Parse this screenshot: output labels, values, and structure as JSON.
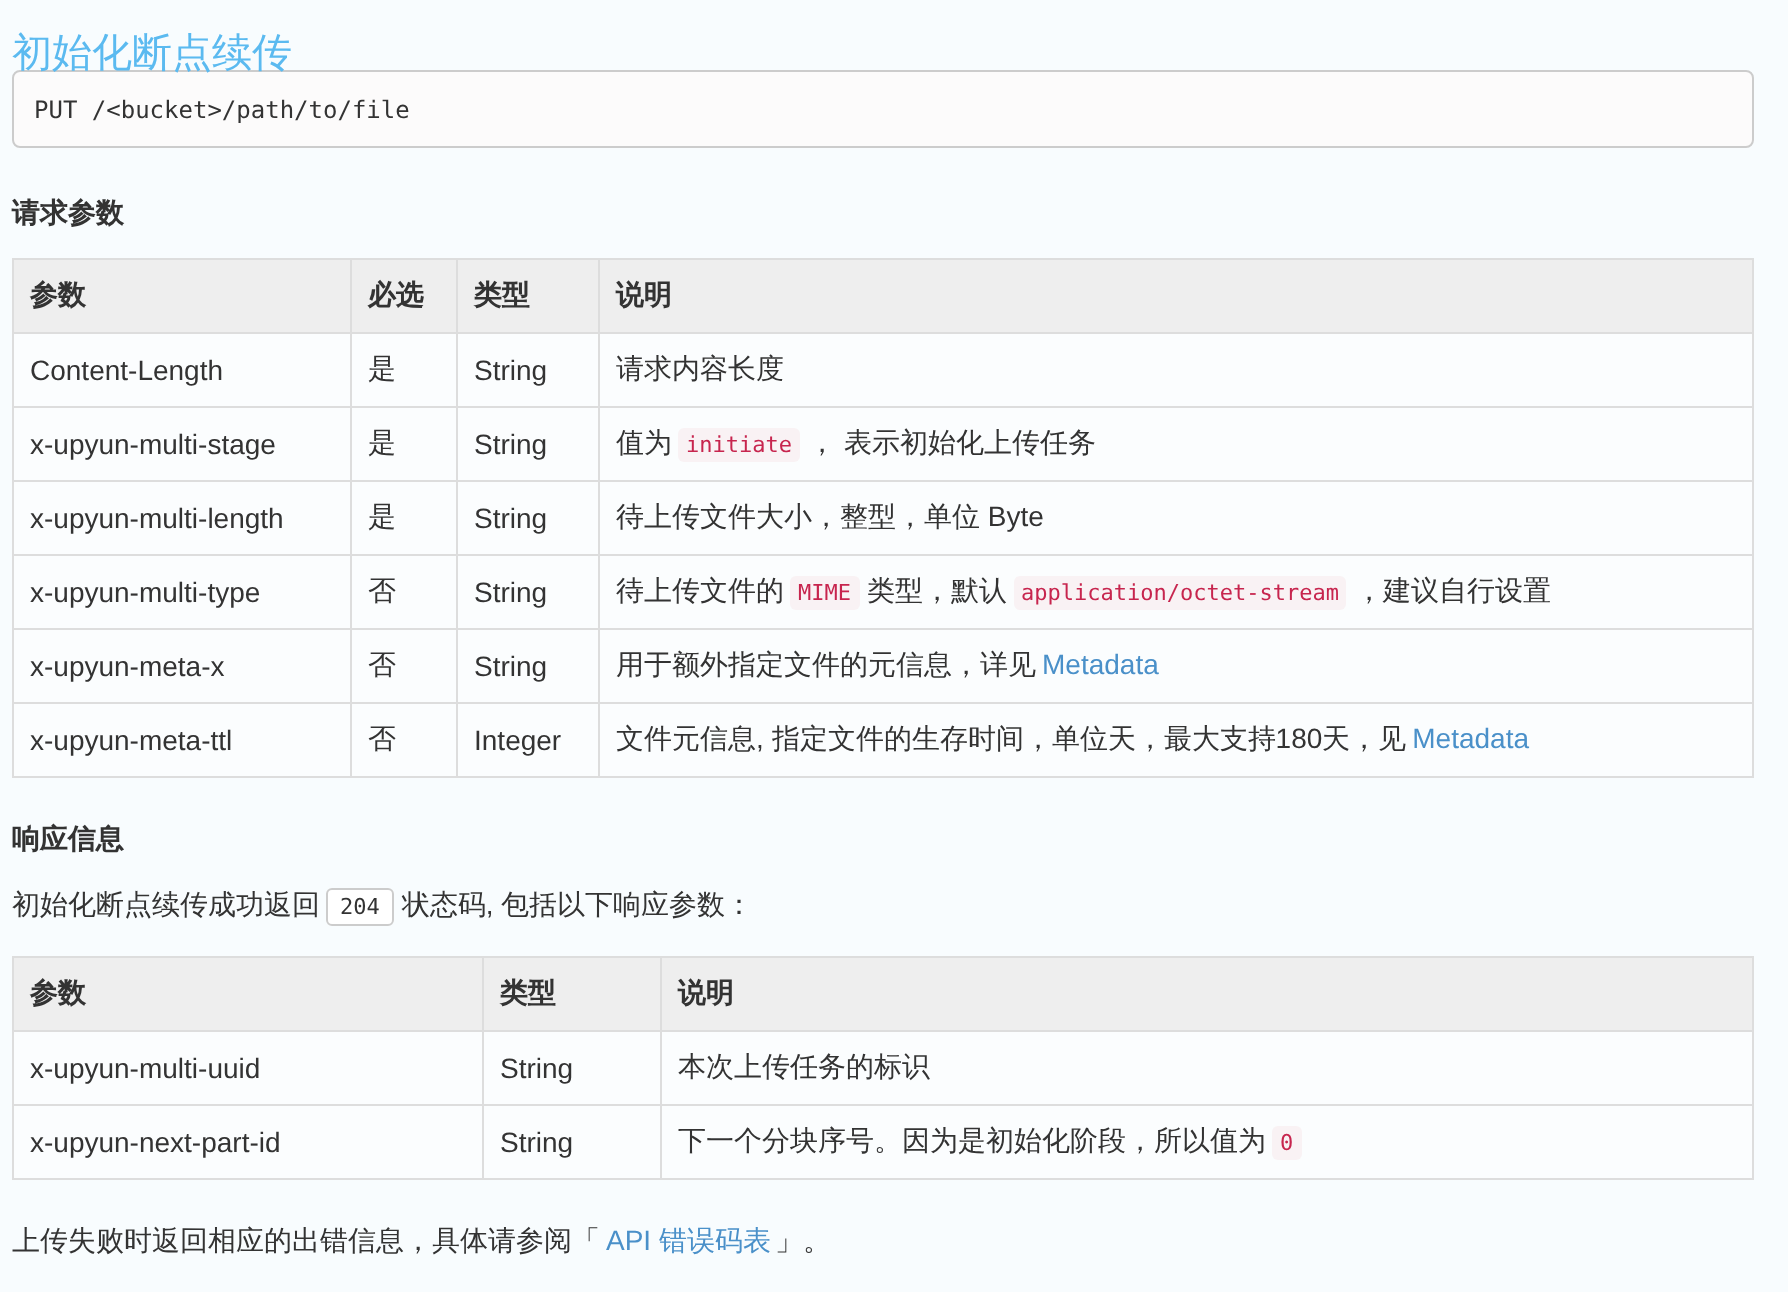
{
  "title": "初始化断点续传",
  "request_line": "PUT /<bucket>/path/to/file",
  "request_heading": "请求参数",
  "request_table": {
    "columns": [
      "参数",
      "必选",
      "类型",
      "说明"
    ],
    "rows": [
      {
        "cells": [
          "Content-Length",
          "是",
          "String"
        ],
        "description": [
          {
            "kind": "text",
            "text": "请求内容长度"
          }
        ]
      },
      {
        "cells": [
          "x-upyun-multi-stage",
          "是",
          "String"
        ],
        "description": [
          {
            "kind": "text",
            "text": "值为"
          },
          {
            "kind": "code",
            "text": "initiate"
          },
          {
            "kind": "text",
            "text": "， 表示初始化上传任务"
          }
        ]
      },
      {
        "cells": [
          "x-upyun-multi-length",
          "是",
          "String"
        ],
        "description": [
          {
            "kind": "text",
            "text": "待上传文件大小，整型，单位 Byte"
          }
        ]
      },
      {
        "cells": [
          "x-upyun-multi-type",
          "否",
          "String"
        ],
        "description": [
          {
            "kind": "text",
            "text": "待上传文件的"
          },
          {
            "kind": "code",
            "text": "MIME"
          },
          {
            "kind": "text",
            "text": "类型，默认"
          },
          {
            "kind": "code",
            "text": "application/octet-stream"
          },
          {
            "kind": "text",
            "text": "，建议自行设置"
          }
        ]
      },
      {
        "cells": [
          "x-upyun-meta-x",
          "否",
          "String"
        ],
        "description": [
          {
            "kind": "text",
            "text": "用于额外指定文件的元信息，详见"
          },
          {
            "kind": "link",
            "text": "Metadata"
          }
        ]
      },
      {
        "cells": [
          "x-upyun-meta-ttl",
          "否",
          "Integer"
        ],
        "description": [
          {
            "kind": "text",
            "text": "文件元信息, 指定文件的生存时间，单位天，最大支持180天，见"
          },
          {
            "kind": "link",
            "text": "Metadata"
          }
        ]
      }
    ]
  },
  "response_heading": "响应信息",
  "response_intro": [
    {
      "kind": "text",
      "text": "初始化断点续传成功返回"
    },
    {
      "kind": "badge",
      "text": "204"
    },
    {
      "kind": "text",
      "text": "状态码, 包括以下响应参数："
    }
  ],
  "response_table": {
    "columns": [
      "参数",
      "类型",
      "说明"
    ],
    "rows": [
      {
        "cells": [
          "x-upyun-multi-uuid",
          "String"
        ],
        "description": [
          {
            "kind": "text",
            "text": "本次上传任务的标识"
          }
        ]
      },
      {
        "cells": [
          "x-upyun-next-part-id",
          "String"
        ],
        "description": [
          {
            "kind": "text",
            "text": "下一个分块序号。因为是初始化阶段，所以值为"
          },
          {
            "kind": "code",
            "text": "0"
          }
        ]
      }
    ]
  },
  "footer": [
    {
      "kind": "text",
      "text": "上传失败时返回相应的出错信息，具体请参阅「"
    },
    {
      "kind": "link",
      "text": "API 错误码表"
    },
    {
      "kind": "text",
      "text": "」。"
    }
  ]
}
